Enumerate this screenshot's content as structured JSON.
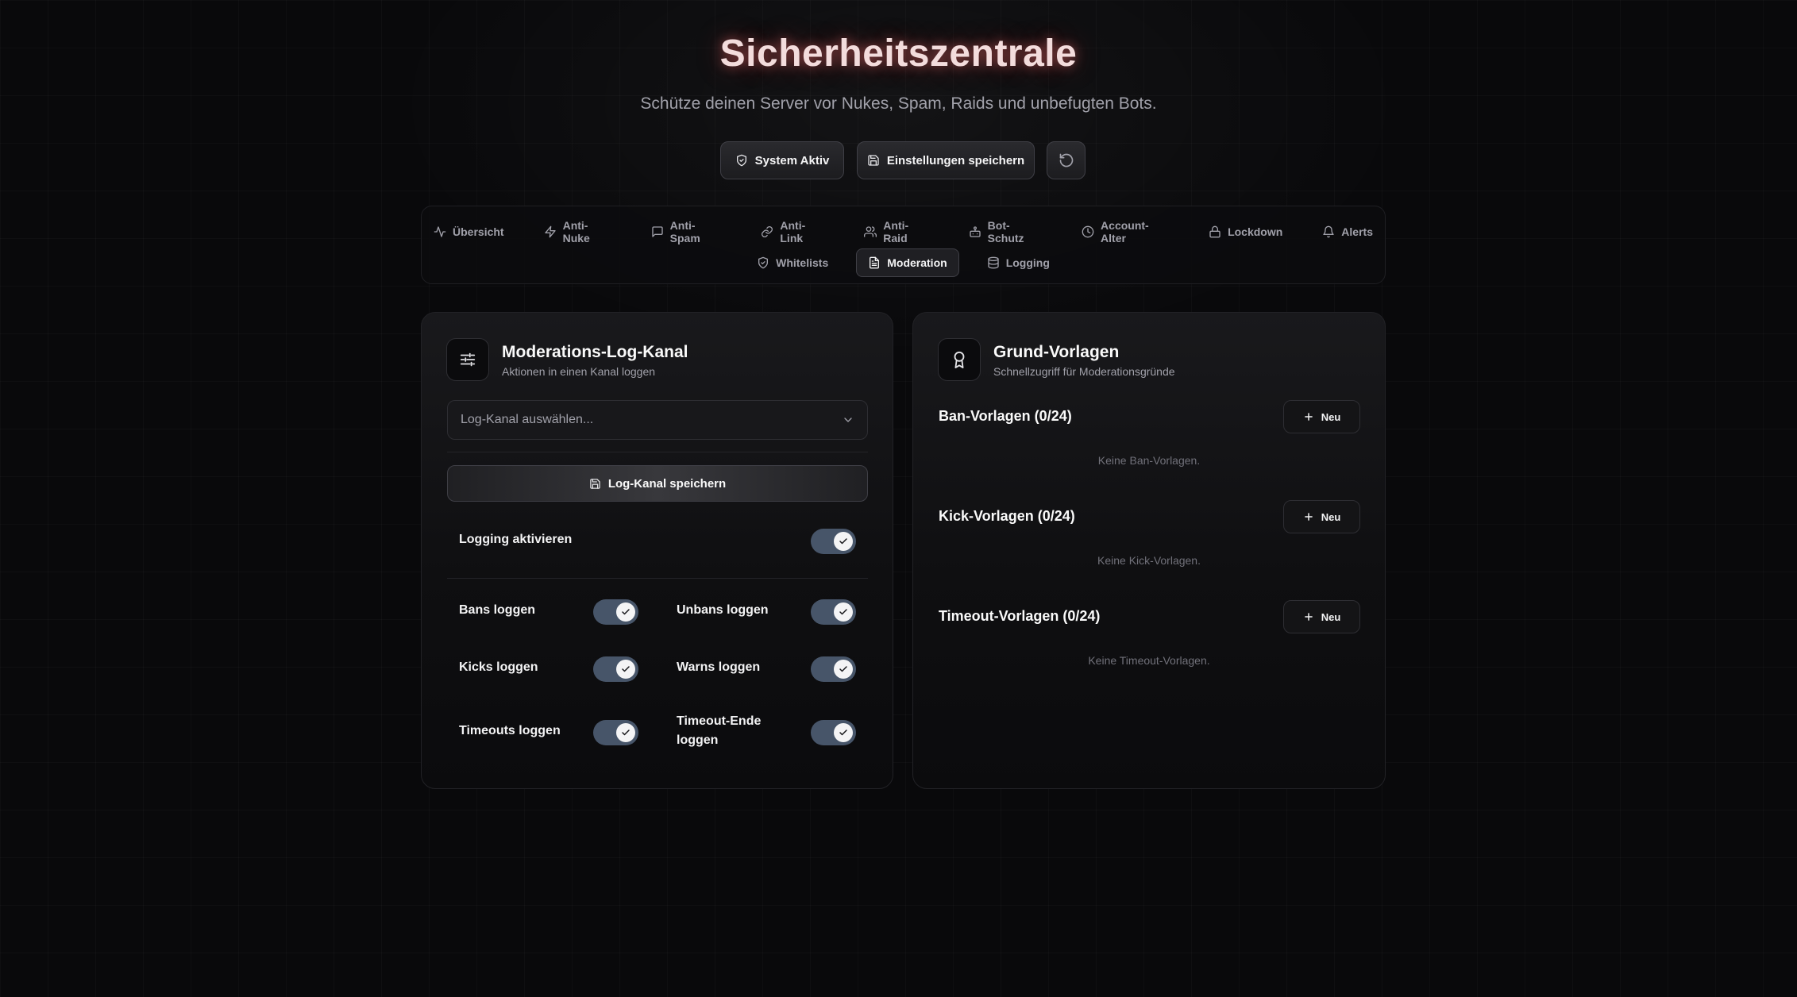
{
  "header": {
    "title": "Sicherheitszentrale",
    "subtitle": "Schütze deinen Server vor Nukes, Spam, Raids und unbefugten Bots.",
    "status_label": "System Aktiv",
    "save_label": "Einstellungen speichern"
  },
  "nav": {
    "tabs_row1": [
      {
        "label": "Übersicht",
        "icon": "activity-icon"
      },
      {
        "label": "Anti-Nuke",
        "icon": "zap-icon"
      },
      {
        "label": "Anti-Spam",
        "icon": "message-square-icon"
      },
      {
        "label": "Anti-Link",
        "icon": "link-icon"
      },
      {
        "label": "Anti-Raid",
        "icon": "users-icon"
      },
      {
        "label": "Bot-Schutz",
        "icon": "bot-icon"
      },
      {
        "label": "Account-Alter",
        "icon": "clock-icon"
      },
      {
        "label": "Lockdown",
        "icon": "lock-icon"
      },
      {
        "label": "Alerts",
        "icon": "bell-icon"
      }
    ],
    "tabs_row2": [
      {
        "label": "Whitelists",
        "icon": "shield-check-icon"
      },
      {
        "label": "Moderation",
        "icon": "file-text-icon",
        "active": true
      },
      {
        "label": "Logging",
        "icon": "database-icon"
      }
    ]
  },
  "log_card": {
    "title": "Moderations-Log-Kanal",
    "subtitle": "Aktionen in einen Kanal loggen",
    "select_placeholder": "Log-Kanal auswählen...",
    "save_label": "Log-Kanal speichern",
    "logging_enabled_label": "Logging aktivieren",
    "logging_enabled": true,
    "toggles": [
      {
        "label": "Bans loggen",
        "on": true
      },
      {
        "label": "Unbans loggen",
        "on": true
      },
      {
        "label": "Kicks loggen",
        "on": true
      },
      {
        "label": "Warns loggen",
        "on": true
      },
      {
        "label": "Timeouts loggen",
        "on": true
      },
      {
        "label": "Timeout-Ende loggen",
        "on": true
      }
    ]
  },
  "templates_card": {
    "title": "Grund-Vorlagen",
    "subtitle": "Schnellzugriff für Moderationsgründe",
    "new_label": "Neu",
    "sections": [
      {
        "title": "Ban-Vorlagen (0/24)",
        "empty": "Keine Ban-Vorlagen."
      },
      {
        "title": "Kick-Vorlagen (0/24)",
        "empty": "Keine Kick-Vorlagen."
      },
      {
        "title": "Timeout-Vorlagen (0/24)",
        "empty": "Keine Timeout-Vorlagen."
      }
    ]
  },
  "colors": {
    "background": "#09090b",
    "title_glow": "#ef4444",
    "toggle_track": "#475569",
    "card": "#141416"
  }
}
